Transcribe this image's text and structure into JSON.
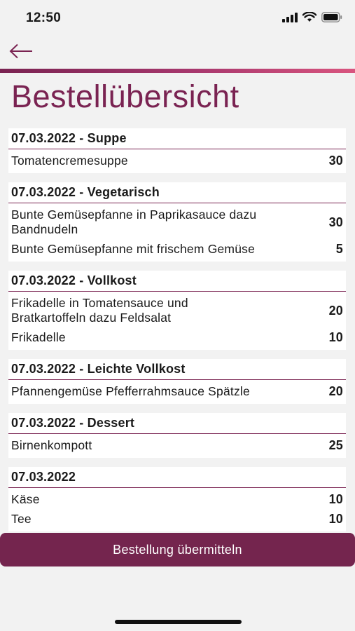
{
  "status_bar": {
    "time": "12:50"
  },
  "nav": {
    "back_icon": "arrow-left-icon"
  },
  "colors": {
    "accent": "#7a2352",
    "button": "#74254e",
    "background": "#f2f2f2"
  },
  "page": {
    "title": "Bestellübersicht"
  },
  "sections": [
    {
      "header": "07.03.2022 - Suppe",
      "items": [
        {
          "name": "Tomatencremesuppe",
          "qty": "30"
        }
      ]
    },
    {
      "header": "07.03.2022 - Vegetarisch",
      "items": [
        {
          "name": "Bunte Gemüsepfanne in Paprikasauce dazu Bandnudeln",
          "qty": "30"
        },
        {
          "name": "Bunte Gemüsepfanne mit frischem Gemüse",
          "qty": "5"
        }
      ]
    },
    {
      "header": "07.03.2022 - Vollkost",
      "items": [
        {
          "name": "Frikadelle in Tomatensauce und Bratkartoffeln dazu Feldsalat",
          "qty": "20"
        },
        {
          "name": "Frikadelle",
          "qty": "10"
        }
      ]
    },
    {
      "header": "07.03.2022 - Leichte Vollkost",
      "items": [
        {
          "name": "Pfannengemüse Pfefferrahmsauce Spätzle",
          "qty": "20"
        }
      ]
    },
    {
      "header": "07.03.2022 - Dessert",
      "items": [
        {
          "name": "Birnenkompott",
          "qty": "25"
        }
      ]
    },
    {
      "header": "07.03.2022",
      "items": [
        {
          "name": "Käse",
          "qty": "10"
        },
        {
          "name": "Tee",
          "qty": "10"
        }
      ]
    }
  ],
  "actions": {
    "submit_label": "Bestellung übermitteln"
  }
}
